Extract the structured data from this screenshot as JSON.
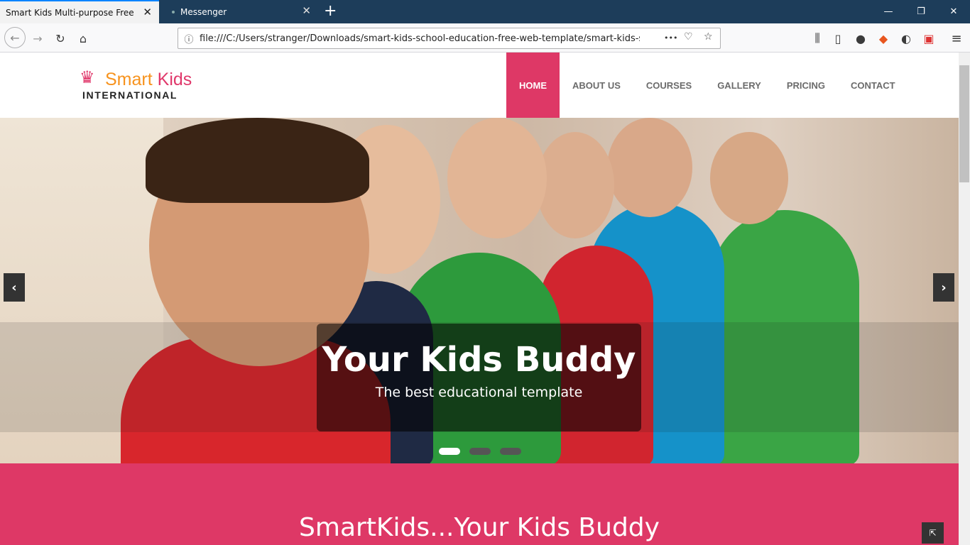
{
  "browser": {
    "tabs": [
      {
        "title": "Smart Kids Multi-purpose Free Boot",
        "close": "✕"
      },
      {
        "title": "Messenger",
        "close": "✕"
      }
    ],
    "new_tab": "+",
    "window_controls": {
      "minimize": "—",
      "restore": "❐",
      "close": "✕"
    },
    "url": "file:///C:/Users/stranger/Downloads/smart-kids-school-education-free-web-template/smart-kids-scho",
    "icons": {
      "back": "←",
      "forward": "→",
      "reload": "↻",
      "home": "⌂",
      "info": "ⓘ",
      "more": "•••",
      "pocket": "♡",
      "star": "☆",
      "library": "⫼",
      "sidebar": "▯",
      "account": "●",
      "ext1": "◆",
      "ext2": "◐",
      "ext3": "▣",
      "menu": "≡"
    }
  },
  "site": {
    "logo": {
      "crown": "♛",
      "smart": "Smart",
      "kids": "Kids",
      "tagline": "INTERNATIONAL"
    },
    "menu": [
      "HOME",
      "ABOUT US",
      "COURSES",
      "GALLERY",
      "PRICING",
      "CONTACT"
    ],
    "active_menu": "HOME",
    "hero": {
      "title": "Your Kids Buddy",
      "subtitle": "The best educational template",
      "prev": "‹",
      "next": "›",
      "slides": 3,
      "active_slide": 1
    },
    "section_title": "SmartKids...Your Kids Buddy",
    "corner_button": "⇱"
  },
  "colors": {
    "brand_pink": "#de3866",
    "brand_orange": "#f7931e",
    "tab_strip": "#1d3d5a"
  }
}
